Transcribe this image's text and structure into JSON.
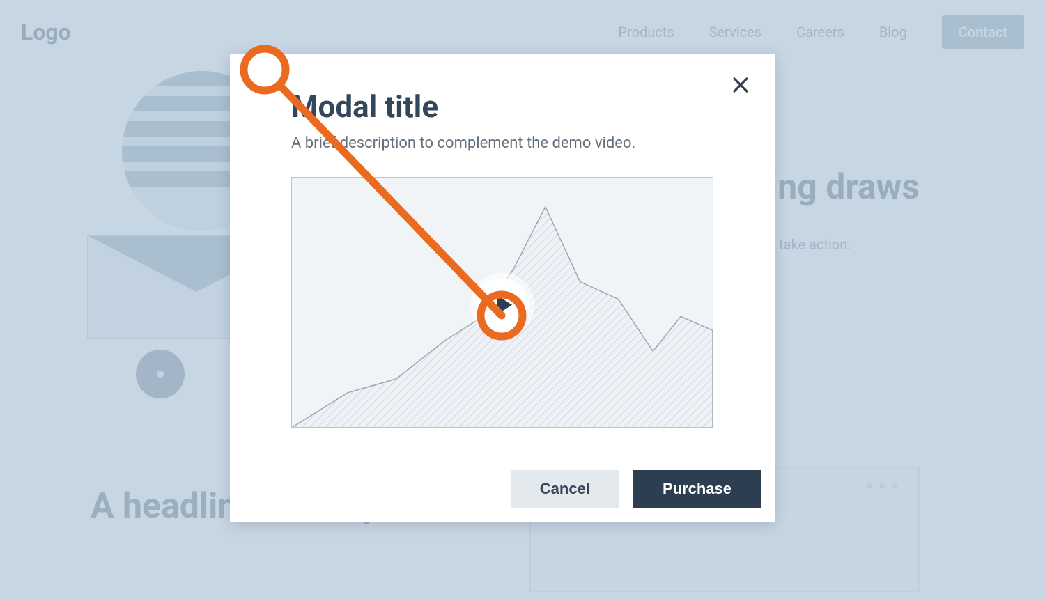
{
  "nav": {
    "logo": "Logo",
    "links": [
      "Products",
      "Services",
      "Careers",
      "Blog"
    ],
    "contact": "Contact"
  },
  "hero": {
    "headline_fragment": "pelling draws",
    "subtext": "who are curious enough to eader to take action."
  },
  "features": {
    "headline": "A headline about product features"
  },
  "modal": {
    "title": "Modal title",
    "description": "A brief description to complement the demo video.",
    "cancel": "Cancel",
    "purchase": "Purchase"
  },
  "annotation": {
    "color": "#ea6a20",
    "origin_label": "modal-corner",
    "target_label": "play-button"
  },
  "chart_data": {
    "type": "area",
    "title": "",
    "xlabel": "",
    "ylabel": "",
    "x": [
      0,
      80,
      150,
      220,
      275,
      320,
      365,
      415,
      470,
      520,
      560,
      606
    ],
    "values": [
      360,
      310,
      290,
      235,
      200,
      130,
      42,
      150,
      175,
      250,
      200,
      220
    ],
    "ylim": [
      0,
      360
    ]
  }
}
